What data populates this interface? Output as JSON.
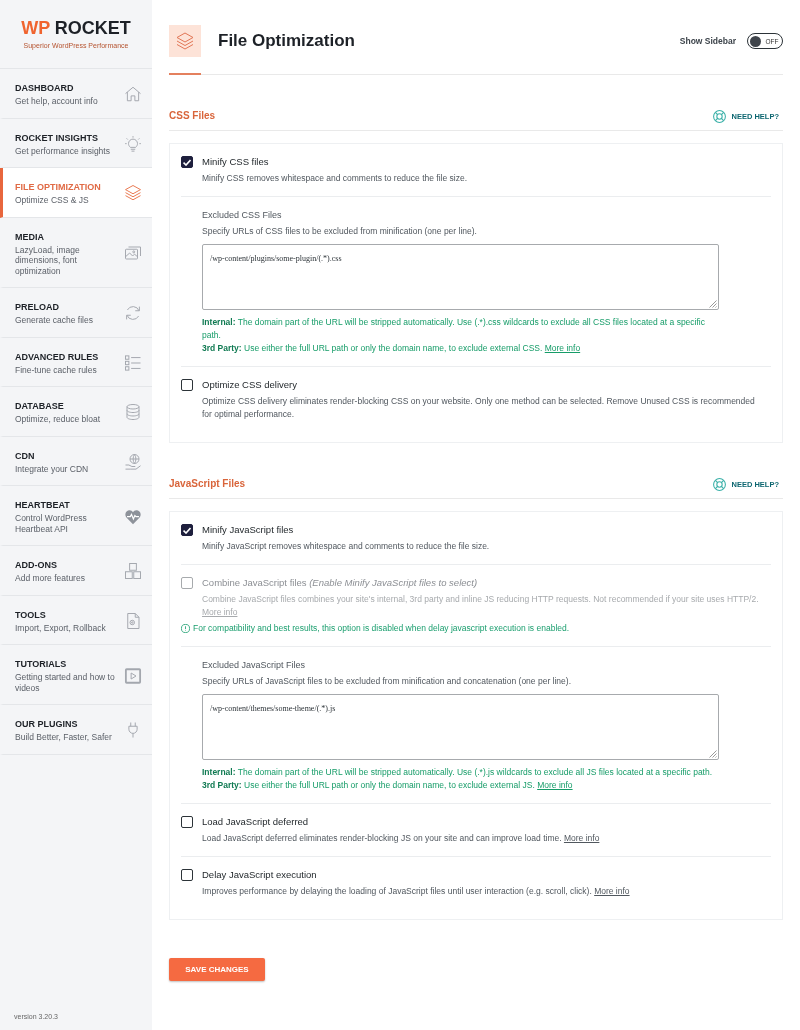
{
  "sidebar": {
    "logo": {
      "mark": "WP",
      "name": "ROCKET",
      "tagline": "Superior WordPress Performance"
    },
    "items": [
      {
        "title": "DASHBOARD",
        "subtitle": "Get help, account info",
        "selected": false
      },
      {
        "title": "ROCKET INSIGHTS",
        "subtitle": "Get performance insights",
        "selected": false
      },
      {
        "title": "FILE OPTIMIZATION",
        "subtitle": "Optimize CSS & JS",
        "selected": true
      },
      {
        "title": "MEDIA",
        "subtitle": "LazyLoad, image dimensions, font optimization",
        "selected": false
      },
      {
        "title": "PRELOAD",
        "subtitle": "Generate cache files",
        "selected": false
      },
      {
        "title": "ADVANCED RULES",
        "subtitle": "Fine-tune cache rules",
        "selected": false
      },
      {
        "title": "DATABASE",
        "subtitle": "Optimize, reduce bloat",
        "selected": false
      },
      {
        "title": "CDN",
        "subtitle": "Integrate your CDN",
        "selected": false
      },
      {
        "title": "HEARTBEAT",
        "subtitle": "Control WordPress Heartbeat API",
        "selected": false
      },
      {
        "title": "ADD-ONS",
        "subtitle": "Add more features",
        "selected": false
      },
      {
        "title": "TOOLS",
        "subtitle": "Import, Export, Rollback",
        "selected": false
      },
      {
        "title": "TUTORIALS",
        "subtitle": "Getting started and how to videos",
        "selected": false
      },
      {
        "title": "OUR PLUGINS",
        "subtitle": "Build Better, Faster, Safer",
        "selected": false
      }
    ],
    "version": "version 3.20.3"
  },
  "header": {
    "title": "File Optimization",
    "show_sidebar": {
      "label": "Show Sidebar",
      "on": false,
      "state": "OFF"
    }
  },
  "sections": [
    {
      "title": "CSS Files",
      "help": "NEED HELP?",
      "options": [
        {
          "kind": "checkbox",
          "label": "Minify CSS files",
          "description": "Minify CSS removes whitespace and comments to reduce the file size.",
          "checked": true,
          "disabled": false
        },
        {
          "kind": "field",
          "title": "Excluded CSS Files",
          "description": "Specify URLs of CSS files to be excluded from minification (one per line).",
          "value": "/wp-content/plugins/some-plugin/(.*).css",
          "notes": [
            {
              "text": "**Internal:** The domain part of the URL will be stripped automatically. Use (.*).css wildcards to exclude all CSS files located at a specific path."
            },
            {
              "text": "**3rd Party:** Use either the full URL path or only the domain name, to exclude external CSS.",
              "link": "More info"
            }
          ]
        },
        {
          "kind": "checkbox",
          "label": "Optimize CSS delivery",
          "description": "Optimize CSS delivery eliminates render-blocking CSS on your website. Only one method can be selected. Remove Unused CSS is recommended for optimal performance.",
          "checked": false,
          "disabled": false
        }
      ]
    },
    {
      "title": "JavaScript Files",
      "help": "NEED HELP?",
      "options": [
        {
          "kind": "checkbox",
          "label": "Minify JavaScript files",
          "description": "Minify JavaScript removes whitespace and comments to reduce the file size.",
          "checked": true,
          "disabled": false
        },
        {
          "kind": "checkbox",
          "label": "Combine JavaScript files *(Enable Minify JavaScript files to select)*",
          "description": "Combine JavaScript files combines your site's internal, 3rd party and inline JS reducing HTTP requests. Not recommended if your site uses HTTP/2.",
          "link": "More info",
          "checked": false,
          "disabled": true,
          "notice": "For compatibility and best results, this option is disabled when delay javascript execution is enabled."
        },
        {
          "kind": "field",
          "title": "Excluded JavaScript Files",
          "description": "Specify URLs of JavaScript files to be excluded from minification and concatenation (one per line).",
          "value": "/wp-content/themes/some-theme/(.*).js",
          "notes": [
            {
              "text": "**Internal:** The domain part of the URL will be stripped automatically. Use (.*).js wildcards to exclude all JS files located at a specific path."
            },
            {
              "text": "**3rd Party:** Use either the full URL path or only the domain name, to exclude external JS.",
              "link": "More info"
            }
          ]
        },
        {
          "kind": "checkbox",
          "label": "Load JavaScript deferred",
          "description": "Load JavaScript deferred eliminates render-blocking JS on your site and can improve load time.",
          "link": "More info",
          "checked": false,
          "disabled": false
        },
        {
          "kind": "checkbox",
          "label": "Delay JavaScript execution",
          "description": "Improves performance by delaying the loading of JavaScript files until user interaction (e.g. scroll, click).",
          "link": "More info",
          "checked": false,
          "disabled": false
        }
      ]
    }
  ],
  "save_button": "SAVE CHANGES"
}
